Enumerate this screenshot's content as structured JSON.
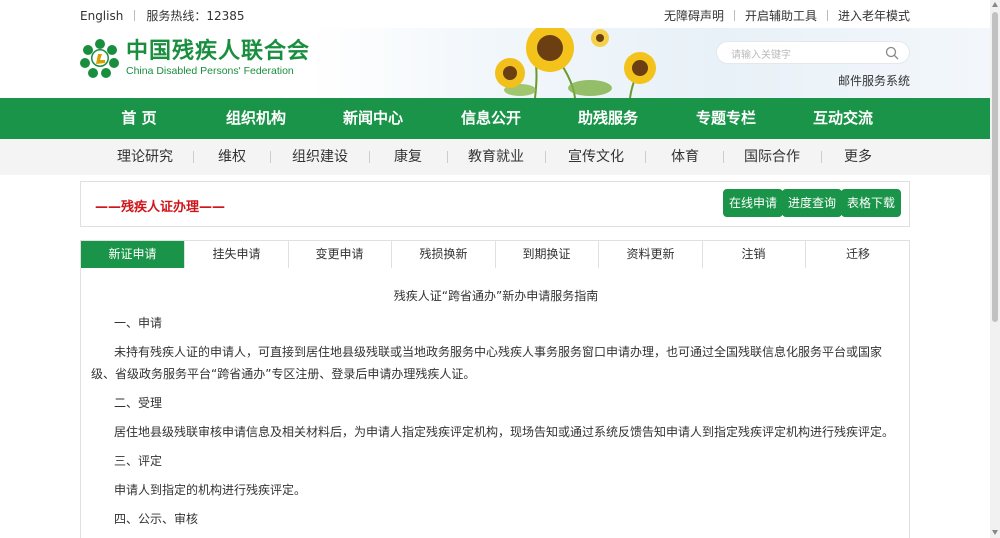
{
  "topbar": {
    "english": "English",
    "hotline": "服务热线：12385",
    "accessibility": "无障碍声明",
    "assist_tools": "开启辅助工具",
    "elder_mode": "进入老年模式"
  },
  "header": {
    "logo_cn": "中国残疾人联合会",
    "logo_en": "China Disabled Persons' Federation",
    "search_placeholder": "请输入关键字",
    "mail_system": "邮件服务系统"
  },
  "main_nav": [
    "首 页",
    "组织机构",
    "新闻中心",
    "信息公开",
    "助残服务",
    "专题专栏",
    "互动交流"
  ],
  "sub_nav": [
    "理论研究",
    "维权",
    "组织建设",
    "康复",
    "教育就业",
    "宣传文化",
    "体育",
    "国际合作",
    "更多"
  ],
  "section": {
    "title": "——残疾人证办理——",
    "buttons": [
      "在线申请",
      "进度查询",
      "表格下载"
    ]
  },
  "tabs": [
    "新证申请",
    "挂失申请",
    "变更申请",
    "残损换新",
    "到期换证",
    "资料更新",
    "注销",
    "迁移"
  ],
  "active_tab": "新证申请",
  "content": {
    "doc_title": "残疾人证“跨省通办”新办申请服务指南",
    "h1": "一、申请",
    "p1": "未持有残疾人证的申请人，可直接到居住地县级残联或当地政务服务中心残疾人事务服务窗口申请办理，也可通过全国残联信息化服务平台或国家级、省级政务服务平台“跨省通办”专区注册、登录后申请办理残疾人证。",
    "h2": "二、受理",
    "p2": "居住地县级残联审核申请信息及相关材料后，为申请人指定残疾评定机构，现场告知或通过系统反馈告知申请人到指定残疾评定机构进行残疾评定。",
    "h3": "三、评定",
    "p3": "申请人到指定的机构进行残疾评定。",
    "h4": "四、公示、审核"
  },
  "colors": {
    "brand_green": "#1a9448",
    "title_red": "#d0151a"
  }
}
